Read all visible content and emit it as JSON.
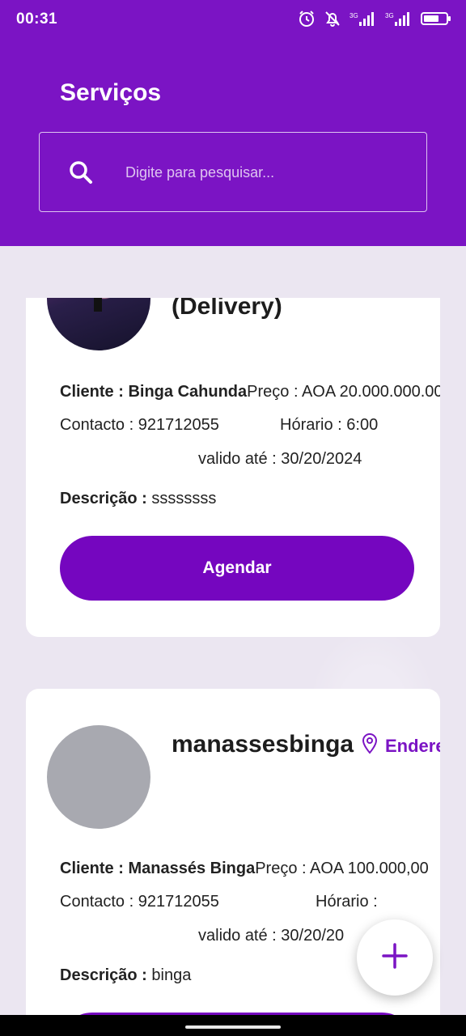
{
  "status_bar": {
    "time": "00:31",
    "icons": [
      "alarm-icon",
      "bell-off-icon",
      "signal-3g-icon",
      "signal-3g-icon",
      "battery-icon"
    ],
    "network_1": "3G",
    "network_2": "3G"
  },
  "header": {
    "title": "Serviços",
    "background": "#7b14c4"
  },
  "search": {
    "placeholder": "Digite para pesquisar...",
    "value": ""
  },
  "cards": [
    {
      "title": "(Delivery)",
      "cliente_label": "Cliente :",
      "cliente": "Binga Cahunda",
      "preco_label": "Preço :",
      "preco": "AOA 20.000.000.00",
      "contacto_label": "Contacto :",
      "contacto": "921712055",
      "horario_label": "Hórario :",
      "horario": "6:00",
      "valido_label": "valido até :",
      "valido": "30/20/2024",
      "descricao_label": "Descrição :",
      "descricao": "ssssssss",
      "button": "Agendar"
    },
    {
      "title": "manassesbinga",
      "address_label": "Endereço",
      "cliente_label": "Cliente :",
      "cliente": "Manassés Binga",
      "preco_label": "Preço :",
      "preco": "AOA 100.000,00",
      "contacto_label": "Contacto :",
      "contacto": "921712055",
      "horario_label": "Hórario :",
      "horario": "",
      "valido_label": "valido até :",
      "valido": "30/20/20",
      "descricao_label": "Descrição :",
      "descricao": "binga"
    }
  ],
  "fab": {
    "icon": "plus-icon",
    "color": "#7b14c4"
  },
  "accent_color": "#7506bf"
}
